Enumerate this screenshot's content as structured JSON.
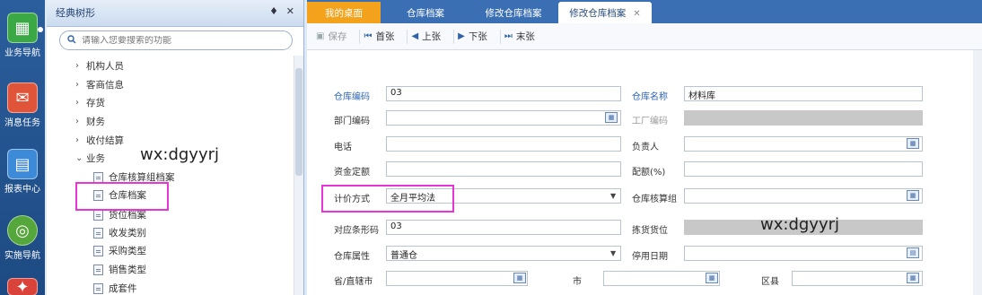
{
  "rail": {
    "items": [
      {
        "label": "业务导航",
        "icon": "grid-icon",
        "color": "#3aa845"
      },
      {
        "label": "消息任务",
        "icon": "mail-icon",
        "color": "#e0553a"
      },
      {
        "label": "报表中心",
        "icon": "report-icon",
        "color": "#3d8ad9"
      },
      {
        "label": "实施导航",
        "icon": "compass-icon",
        "color": "#55a63b"
      }
    ]
  },
  "tree": {
    "title": "经典树形",
    "pin": "♦",
    "close": "✕",
    "search_placeholder": "请输入您要搜索的功能",
    "nodes": [
      {
        "label": "机构人员",
        "kind": "folder",
        "expanded": false
      },
      {
        "label": "客商信息",
        "kind": "folder",
        "expanded": false
      },
      {
        "label": "存货",
        "kind": "folder",
        "expanded": false
      },
      {
        "label": "财务",
        "kind": "folder",
        "expanded": false
      },
      {
        "label": "收付结算",
        "kind": "folder",
        "expanded": false
      },
      {
        "label": "业务",
        "kind": "folder",
        "expanded": true
      },
      {
        "label": "仓库核算组档案",
        "kind": "leaf"
      },
      {
        "label": "仓库档案",
        "kind": "leaf",
        "selected": true
      },
      {
        "label": "货位档案",
        "kind": "leaf"
      },
      {
        "label": "收发类别",
        "kind": "leaf"
      },
      {
        "label": "采购类型",
        "kind": "leaf"
      },
      {
        "label": "销售类型",
        "kind": "leaf"
      },
      {
        "label": "成套件",
        "kind": "leaf"
      }
    ],
    "watermark": "wx:dgyyrj"
  },
  "tabs": [
    {
      "label": "我的桌面",
      "active": false
    },
    {
      "label": "仓库档案",
      "active": false
    },
    {
      "label": "修改仓库档案",
      "active": false
    },
    {
      "label": "修改仓库档案",
      "active": true,
      "close": "✕"
    }
  ],
  "toolbar": {
    "save": "保存",
    "first": "首张",
    "prev": "上张",
    "next": "下张",
    "last": "末张"
  },
  "form": {
    "warehouse_code_label": "仓库编码",
    "warehouse_code": "03",
    "warehouse_name_label": "仓库名称",
    "warehouse_name": "材料库",
    "dept_code_label": "部门编码",
    "dept_code": "",
    "factory_code_label": "工厂编码",
    "phone_label": "电话",
    "phone": "",
    "owner_label": "负责人",
    "owner": "",
    "fund_quota_label": "资金定额",
    "fund_quota": "",
    "ratio_label": "配额(%)",
    "ratio": "",
    "pricing_label": "计价方式",
    "pricing": "全月平均法",
    "account_group_label": "仓库核算组",
    "account_group": "",
    "barcode_label": "对应条形码",
    "barcode": "03",
    "pick_location_label": "拣货货位",
    "attribute_label": "仓库属性",
    "attribute": "普通仓",
    "stop_date_label": "停用日期",
    "stop_date": "",
    "province_label": "省/直辖市",
    "province": "",
    "city_label": "市",
    "city": "",
    "district_label": "区县",
    "district": "",
    "watermark": "wx:dgyyrj"
  }
}
